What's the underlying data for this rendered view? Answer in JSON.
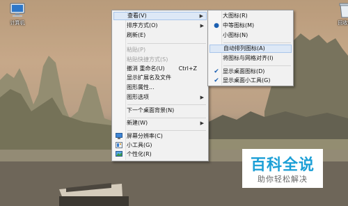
{
  "desktop": {
    "icons": [
      {
        "label": "计算机",
        "icon": "computer-icon"
      },
      {
        "label": "回收站",
        "icon": "recycle-bin-icon"
      }
    ]
  },
  "context_menu": {
    "items": [
      {
        "label": "查看(V)",
        "submenu": true
      },
      {
        "label": "排序方式(O)",
        "submenu": true
      },
      {
        "label": "刷新(E)"
      },
      {
        "label": "粘贴(P)",
        "disabled": true
      },
      {
        "label": "粘贴快捷方式(S)",
        "disabled": true
      },
      {
        "label": "撤消 重命名(U)",
        "shortcut": "Ctrl+Z"
      },
      {
        "label": "显示扩展名及文件"
      },
      {
        "label": "图形属性..."
      },
      {
        "label": "图形选项",
        "submenu": true
      },
      {
        "label": "下一个桌面背景(N)"
      },
      {
        "label": "新建(W)",
        "submenu": true
      },
      {
        "label": "屏幕分辨率(C)",
        "icon": "screen-resolution-icon"
      },
      {
        "label": "小工具(G)",
        "icon": "gadgets-icon"
      },
      {
        "label": "个性化(R)",
        "icon": "personalize-icon"
      }
    ]
  },
  "view_submenu": {
    "items": [
      {
        "label": "大图标(R)"
      },
      {
        "label": "中等图标(M)",
        "selected": true
      },
      {
        "label": "小图标(N)"
      },
      {
        "label": "自动排列图标(A)",
        "hover": true
      },
      {
        "label": "将图标与网格对齐(I)"
      },
      {
        "label": "显示桌面图标(D)",
        "checked": true
      },
      {
        "label": "显示桌面小工具(G)",
        "checked": true
      }
    ]
  },
  "watermark": {
    "title": "百科全说",
    "subtitle": "助你轻松解决"
  }
}
